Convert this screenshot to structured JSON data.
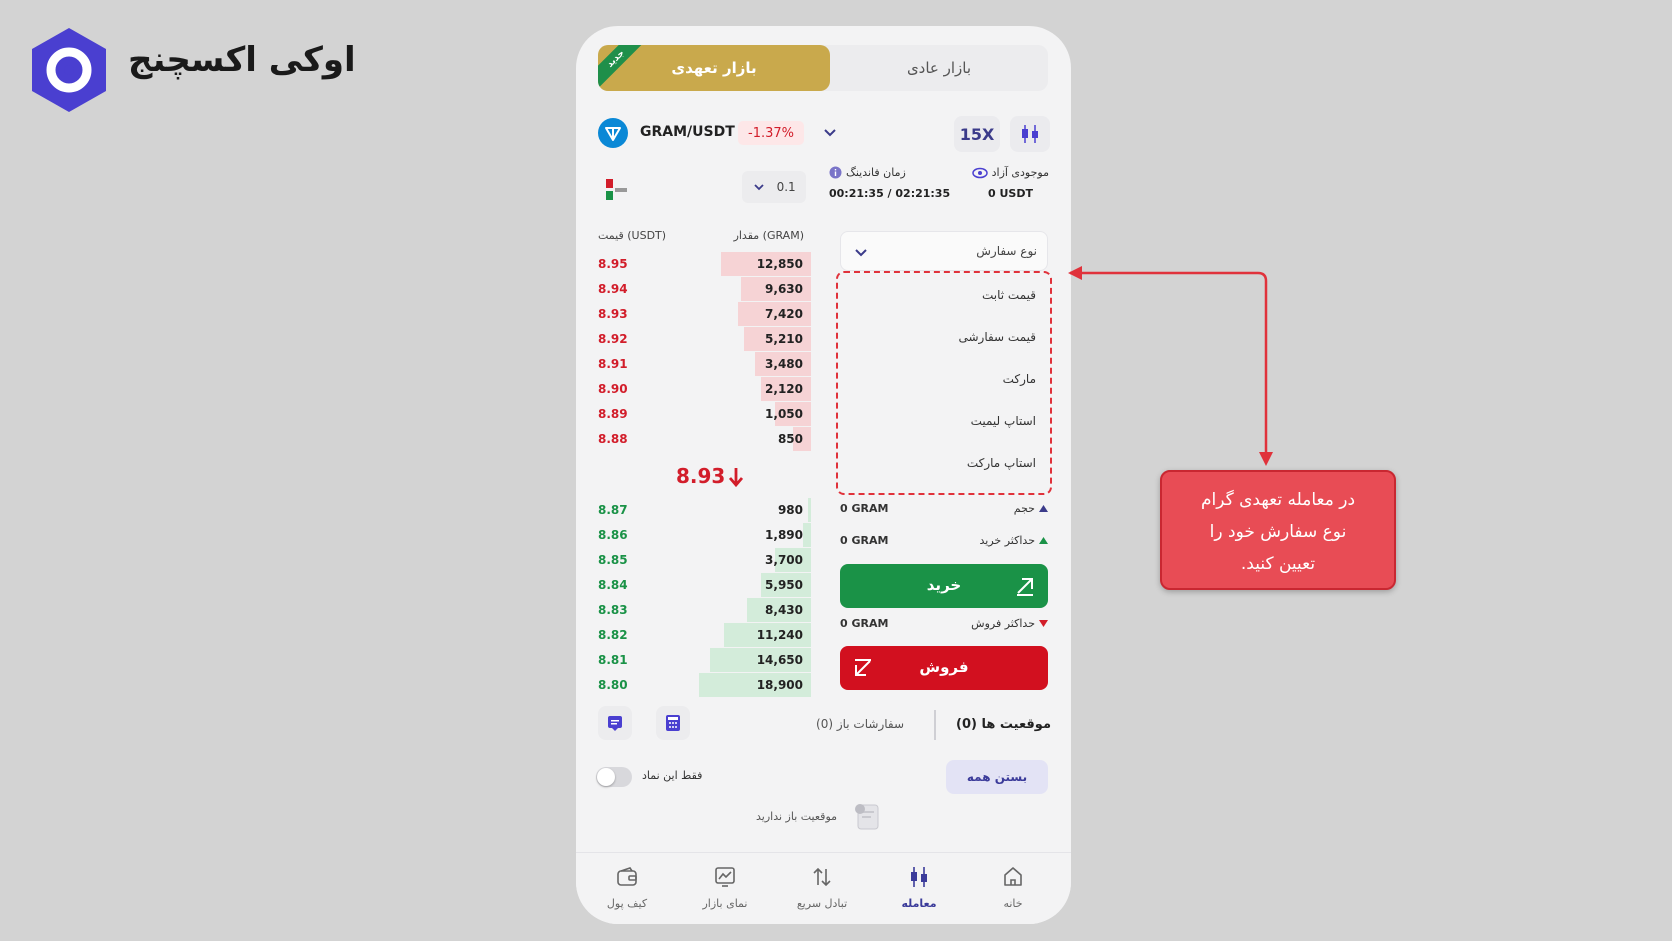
{
  "brand": {
    "name": "اوکی اکسچنج",
    "color": "#4a3fd0"
  },
  "tabs": {
    "futures": "بازار تعهدی",
    "spot": "بازار عادی",
    "new_badge": "جدید"
  },
  "pair": {
    "name": "GRAM/USDT",
    "change": "-1.37%",
    "leverage": "15X"
  },
  "info": {
    "precision": "0.1",
    "funding_label": "زمان فاندینگ",
    "funding_value": "00:21:35 / 02:21:35",
    "free_label": "موجودی آزاد",
    "free_value": "0 USDT"
  },
  "orderbook": {
    "qty_header": "مقدار (GRAM)",
    "price_header": "قیمت (USDT)",
    "asks": [
      {
        "price": "8.95",
        "qty": "12,850",
        "depth": 0.64
      },
      {
        "price": "8.94",
        "qty": "9,630",
        "depth": 0.5
      },
      {
        "price": "8.93",
        "qty": "7,420",
        "depth": 0.52
      },
      {
        "price": "8.92",
        "qty": "5,210",
        "depth": 0.48
      },
      {
        "price": "8.91",
        "qty": "3,480",
        "depth": 0.4
      },
      {
        "price": "8.90",
        "qty": "2,120",
        "depth": 0.36
      },
      {
        "price": "8.89",
        "qty": "1,050",
        "depth": 0.26
      },
      {
        "price": "8.88",
        "qty": "850",
        "depth": 0.13
      }
    ],
    "mid_price": "8.93",
    "bids": [
      {
        "price": "8.87",
        "qty": "980",
        "depth": 0.02
      },
      {
        "price": "8.86",
        "qty": "1,890",
        "depth": 0.06
      },
      {
        "price": "8.85",
        "qty": "3,700",
        "depth": 0.26
      },
      {
        "price": "8.84",
        "qty": "5,950",
        "depth": 0.36
      },
      {
        "price": "8.83",
        "qty": "8,430",
        "depth": 0.46
      },
      {
        "price": "8.82",
        "qty": "11,240",
        "depth": 0.62
      },
      {
        "price": "8.81",
        "qty": "14,650",
        "depth": 0.72
      },
      {
        "price": "8.80",
        "qty": "18,900",
        "depth": 0.8
      }
    ]
  },
  "form": {
    "order_type_label": "نوع سفارش",
    "order_types": [
      "قیمت ثابت",
      "قیمت سفارشی",
      "مارکت",
      "استاپ لیمیت",
      "استاپ مارکت"
    ],
    "available_label": "حجم",
    "available_value": "0 GRAM",
    "max_buy_label": "حداکثر خرید",
    "max_buy_value": "0 GRAM",
    "buy_label": "خرید",
    "max_sell_label": "حداکثر فروش",
    "max_sell_value": "0 GRAM",
    "sell_label": "فروش"
  },
  "positions": {
    "positions_tab": "موقعیت ها (0)",
    "open_orders_tab": "سفارشات باز (0)",
    "close_all": "بستن همه",
    "only_symbol": "فقط این نماد",
    "empty": "موقعیت باز ندارید"
  },
  "nav": {
    "home": "خانه",
    "trade": "معامله",
    "swap": "تبادل سریع",
    "market": "نمای بازار",
    "wallet": "کیف پول"
  },
  "callout": {
    "line1": "در معامله تعهدی گرام",
    "line2": "نوع سفارش خود را",
    "line3": "تعیین کنید."
  },
  "colors": {
    "buy": "#1a9247",
    "sell": "#d2101f",
    "accent": "#c9a94c",
    "annotation": "#e84c55"
  }
}
